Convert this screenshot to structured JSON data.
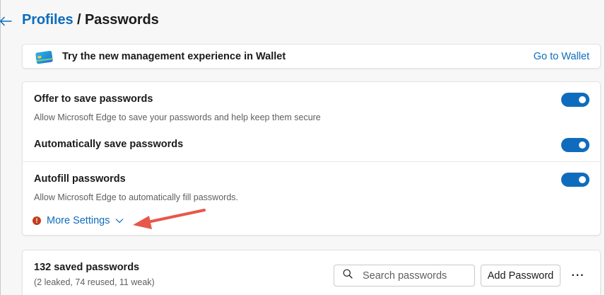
{
  "header": {
    "breadcrumb_parent": "Profiles",
    "separator": " / ",
    "current": "Passwords",
    "back_icon": "arrow-left-icon"
  },
  "wallet_banner": {
    "icon": "wallet-card-icon",
    "text": "Try the new management experience in Wallet",
    "link": "Go to Wallet"
  },
  "settings": {
    "offer_save": {
      "title": "Offer to save passwords",
      "description": "Allow Microsoft Edge to save your passwords and help keep them secure",
      "enabled": true
    },
    "auto_save": {
      "title": "Automatically save passwords",
      "enabled": true
    },
    "autofill": {
      "title": "Autofill passwords",
      "description": "Allow Microsoft Edge to automatically fill passwords.",
      "enabled": true
    },
    "more_settings": {
      "label": "More Settings",
      "alert_glyph": "!",
      "icon": "chevron-down-icon"
    }
  },
  "annotation": {
    "icon": "red-arrow-annotation",
    "color": "#e8574a"
  },
  "passwords_list": {
    "count_title": "132 saved passwords",
    "summary": "(2 leaked, 74 reused, 11 weak)",
    "search_placeholder": "Search passwords",
    "search_value": "",
    "add_button": "Add Password",
    "more_options": "···"
  },
  "colors": {
    "accent": "#0f6cbd",
    "alert": "#c43b1d",
    "background": "#f7f7f7"
  }
}
